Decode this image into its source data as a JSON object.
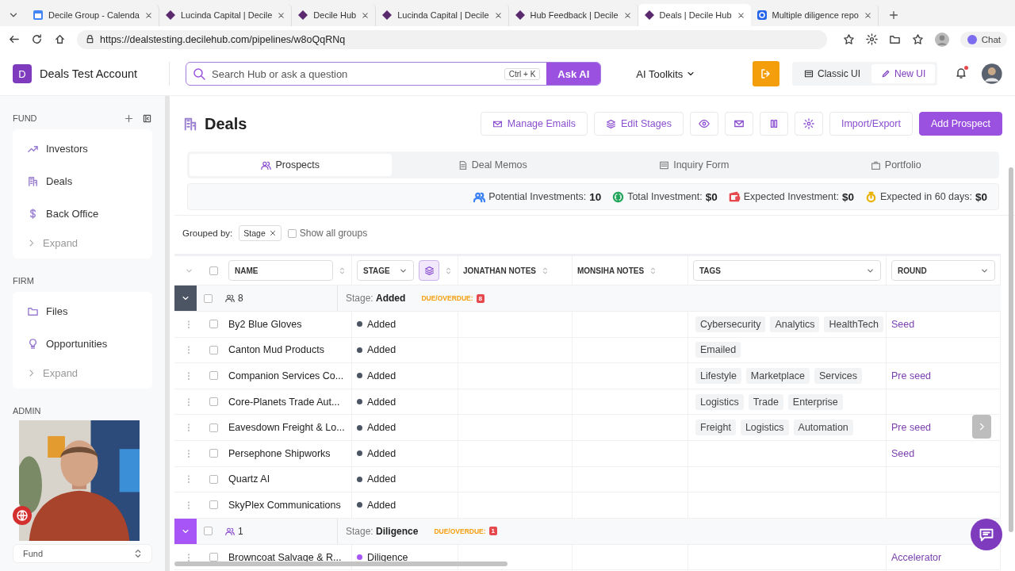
{
  "browser": {
    "tabs": [
      {
        "title": "Decile Group - Calenda",
        "kind": "calendar",
        "selected": false
      },
      {
        "title": "Lucinda Capital | Decile",
        "kind": "diamond",
        "selected": false
      },
      {
        "title": "Decile Hub",
        "kind": "diamond",
        "selected": false
      },
      {
        "title": "Lucinda Capital | Decile",
        "kind": "diamond",
        "selected": false
      },
      {
        "title": "Hub Feedback | Decile",
        "kind": "diamond",
        "selected": false
      },
      {
        "title": "Deals | Decile Hub",
        "kind": "diamond",
        "selected": true
      },
      {
        "title": "Multiple diligence repo",
        "kind": "gear",
        "selected": false
      }
    ],
    "url": "https://dealstesting.decilehub.com/pipelines/w8oQqRNq",
    "chat": "Chat"
  },
  "header": {
    "account": {
      "initial": "D",
      "name": "Deals Test Account"
    },
    "search": {
      "placeholder": "Search Hub or ask a question",
      "shortcut": "Ctrl + K",
      "button": "Ask AI"
    },
    "toolkits": "AI Toolkits",
    "views": [
      {
        "label": "Classic UI",
        "selected": false
      },
      {
        "label": "New UI",
        "selected": true
      }
    ]
  },
  "sidebar": {
    "sections": [
      {
        "title": "FUND",
        "items": [
          {
            "label": "Investors",
            "kind": "link"
          },
          {
            "label": "Deals",
            "kind": "link"
          },
          {
            "label": "Back Office",
            "kind": "link"
          },
          {
            "label": "Expand",
            "kind": "expand"
          }
        ]
      },
      {
        "title": "FIRM",
        "items": [
          {
            "label": "Files",
            "kind": "link"
          },
          {
            "label": "Opportunities",
            "kind": "link"
          },
          {
            "label": "Expand",
            "kind": "expand"
          }
        ]
      },
      {
        "title": "ADMIN"
      }
    ],
    "selector": "Fund"
  },
  "page": {
    "title": "Deals",
    "left_actions": [
      "Manage Emails",
      "Edit Stages"
    ],
    "right_actions": [
      {
        "label": "Import/Export",
        "kind": "outline"
      },
      {
        "label": "Add Prospect",
        "kind": "primary"
      }
    ],
    "tabs": [
      {
        "label": "Prospects",
        "selected": true
      },
      {
        "label": "Deal Memos",
        "selected": false
      },
      {
        "label": "Inquiry Form",
        "selected": false
      },
      {
        "label": "Portfolio",
        "selected": false
      }
    ],
    "stats": [
      {
        "label": "Potential Investments:",
        "value": "10",
        "color": "#3b82f6"
      },
      {
        "label": "Total Investment:",
        "value": "$0",
        "color": "#22a55b"
      },
      {
        "label": "Expected Investment:",
        "value": "$0",
        "color": "#e5484d"
      },
      {
        "label": "Expected in 60 days:",
        "value": "$0",
        "color": "#eab308"
      }
    ],
    "grouped_by": {
      "label": "Grouped by:",
      "chip": "Stage",
      "show_all": {
        "label": "Show all groups",
        "checked": false
      }
    }
  },
  "table": {
    "columns": [
      "NAME",
      "STAGE",
      "JONATHAN NOTES",
      "MONSIHA NOTES",
      "TAGS",
      "ROUND"
    ],
    "all_checked": false,
    "groups": [
      {
        "count": "8",
        "stage_label": "Stage:",
        "stage": "Added",
        "due_label": "DUE/OVERDUE:",
        "due_count": "8",
        "color": "#4b5563",
        "checked": false,
        "rows": [
          {
            "name": "By2 Blue Gloves",
            "stage": "Added",
            "tags": [
              "Cybersecurity",
              "Analytics",
              "HealthTech"
            ],
            "round": "Seed",
            "checked": false
          },
          {
            "name": "Canton Mud Products",
            "stage": "Added",
            "tags": [
              "Emailed"
            ],
            "checked": false
          },
          {
            "name": "Companion Services Co...",
            "stage": "Added",
            "tags": [
              "Lifestyle",
              "Marketplace",
              "Services"
            ],
            "round": "Pre seed",
            "checked": false
          },
          {
            "name": "Core-Planets Trade Aut...",
            "stage": "Added",
            "tags": [
              "Logistics",
              "Trade",
              "Enterprise"
            ],
            "checked": false
          },
          {
            "name": "Eavesdown Freight & Lo...",
            "stage": "Added",
            "tags": [
              "Freight",
              "Logistics",
              "Automation"
            ],
            "round": "Pre seed",
            "checked": false
          },
          {
            "name": "Persephone Shipworks",
            "stage": "Added",
            "round": "Seed",
            "checked": false
          },
          {
            "name": "Quartz AI",
            "stage": "Added",
            "checked": false
          },
          {
            "name": "SkyPlex Communications",
            "stage": "Added",
            "checked": false
          }
        ]
      },
      {
        "count": "1",
        "stage_label": "Stage:",
        "stage": "Diligence",
        "due_label": "DUE/OVERDUE:",
        "due_count": "1",
        "color": "#a855f7",
        "checked": false,
        "rows": [
          {
            "name": "Browncoat Salvage & R...",
            "stage": "Diligence",
            "round": "Accelerator",
            "checked": false
          }
        ]
      }
    ]
  }
}
